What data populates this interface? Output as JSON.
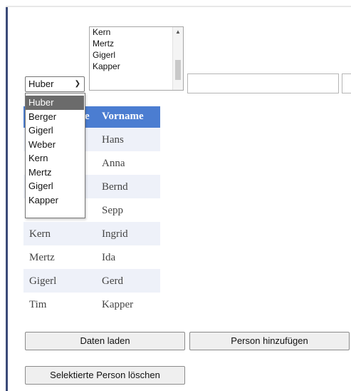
{
  "listbox": {
    "options": [
      "Kern",
      "Mertz",
      "Gigerl",
      "Kapper"
    ]
  },
  "select": {
    "value": "Huber"
  },
  "dropdown": {
    "options": [
      "Huber",
      "Berger",
      "Gigerl",
      "Weber",
      "Kern",
      "Mertz",
      "Gigerl",
      "Kapper"
    ],
    "selected_index": 0
  },
  "table": {
    "header_partial": "e",
    "header_vorname": "Vorname",
    "rows": [
      {
        "name": "",
        "vorname": "Hans"
      },
      {
        "name": "",
        "vorname": "Anna"
      },
      {
        "name": "",
        "vorname": "Bernd"
      },
      {
        "name": "",
        "vorname": "Sepp"
      },
      {
        "name": "Kern",
        "vorname": "Ingrid"
      },
      {
        "name": "Mertz",
        "vorname": "Ida"
      },
      {
        "name": "Gigerl",
        "vorname": "Gerd"
      },
      {
        "name": "Tim",
        "vorname": "Kapper"
      }
    ]
  },
  "buttons": {
    "laden": "Daten laden",
    "add": "Person hinzufügen",
    "delete": "Selektierte Person löschen"
  },
  "colors": {
    "header": "#4b7dd1",
    "row_alt": "#eef1f9",
    "selected_option": "#6b6b6b"
  }
}
